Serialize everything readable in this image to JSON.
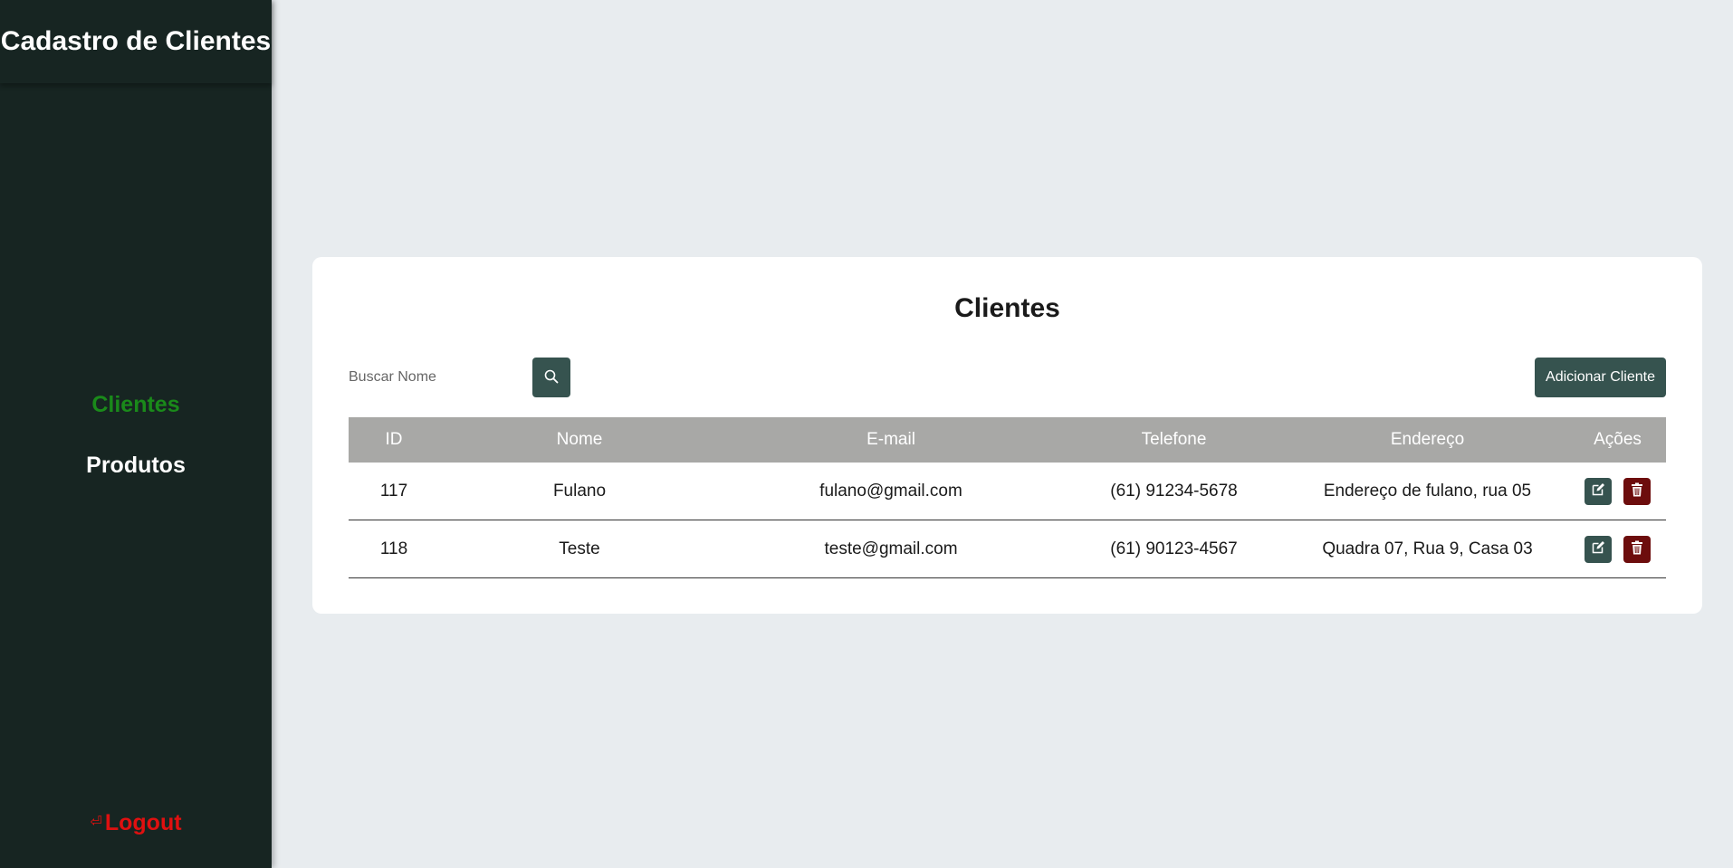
{
  "app": {
    "title": "Cadastro de Clientes"
  },
  "sidebar": {
    "items": [
      {
        "label": "Clientes",
        "active": true
      },
      {
        "label": "Produtos",
        "active": false
      }
    ],
    "logout": {
      "label": "Logout",
      "icon": "logout-icon"
    }
  },
  "main": {
    "title": "Clientes",
    "search": {
      "placeholder": "Buscar Nome",
      "value": "",
      "button_icon": "search-icon"
    },
    "add_button_label": "Adicionar Cliente",
    "table": {
      "headers": [
        "ID",
        "Nome",
        "E-mail",
        "Telefone",
        "Endereço",
        "Ações"
      ],
      "rows": [
        [
          "117",
          "Fulano",
          "fulano@gmail.com",
          "(61) 91234-5678",
          "Endereço de fulano, rua 05"
        ],
        [
          "118",
          "Teste",
          "teste@gmail.com",
          "(61) 90123-4567",
          "Quadra 07, Rua 9, Casa 03"
        ]
      ],
      "row_actions": [
        "edit-icon",
        "trash-icon"
      ]
    }
  },
  "colors": {
    "sidebar_bg": "#172522",
    "active_nav": "#1a8a1a",
    "logout": "#e01010",
    "primary_button": "#36534f",
    "delete_button": "#6d0d0d",
    "table_header": "#a8a8a6",
    "page_bg": "#e8ecef"
  }
}
